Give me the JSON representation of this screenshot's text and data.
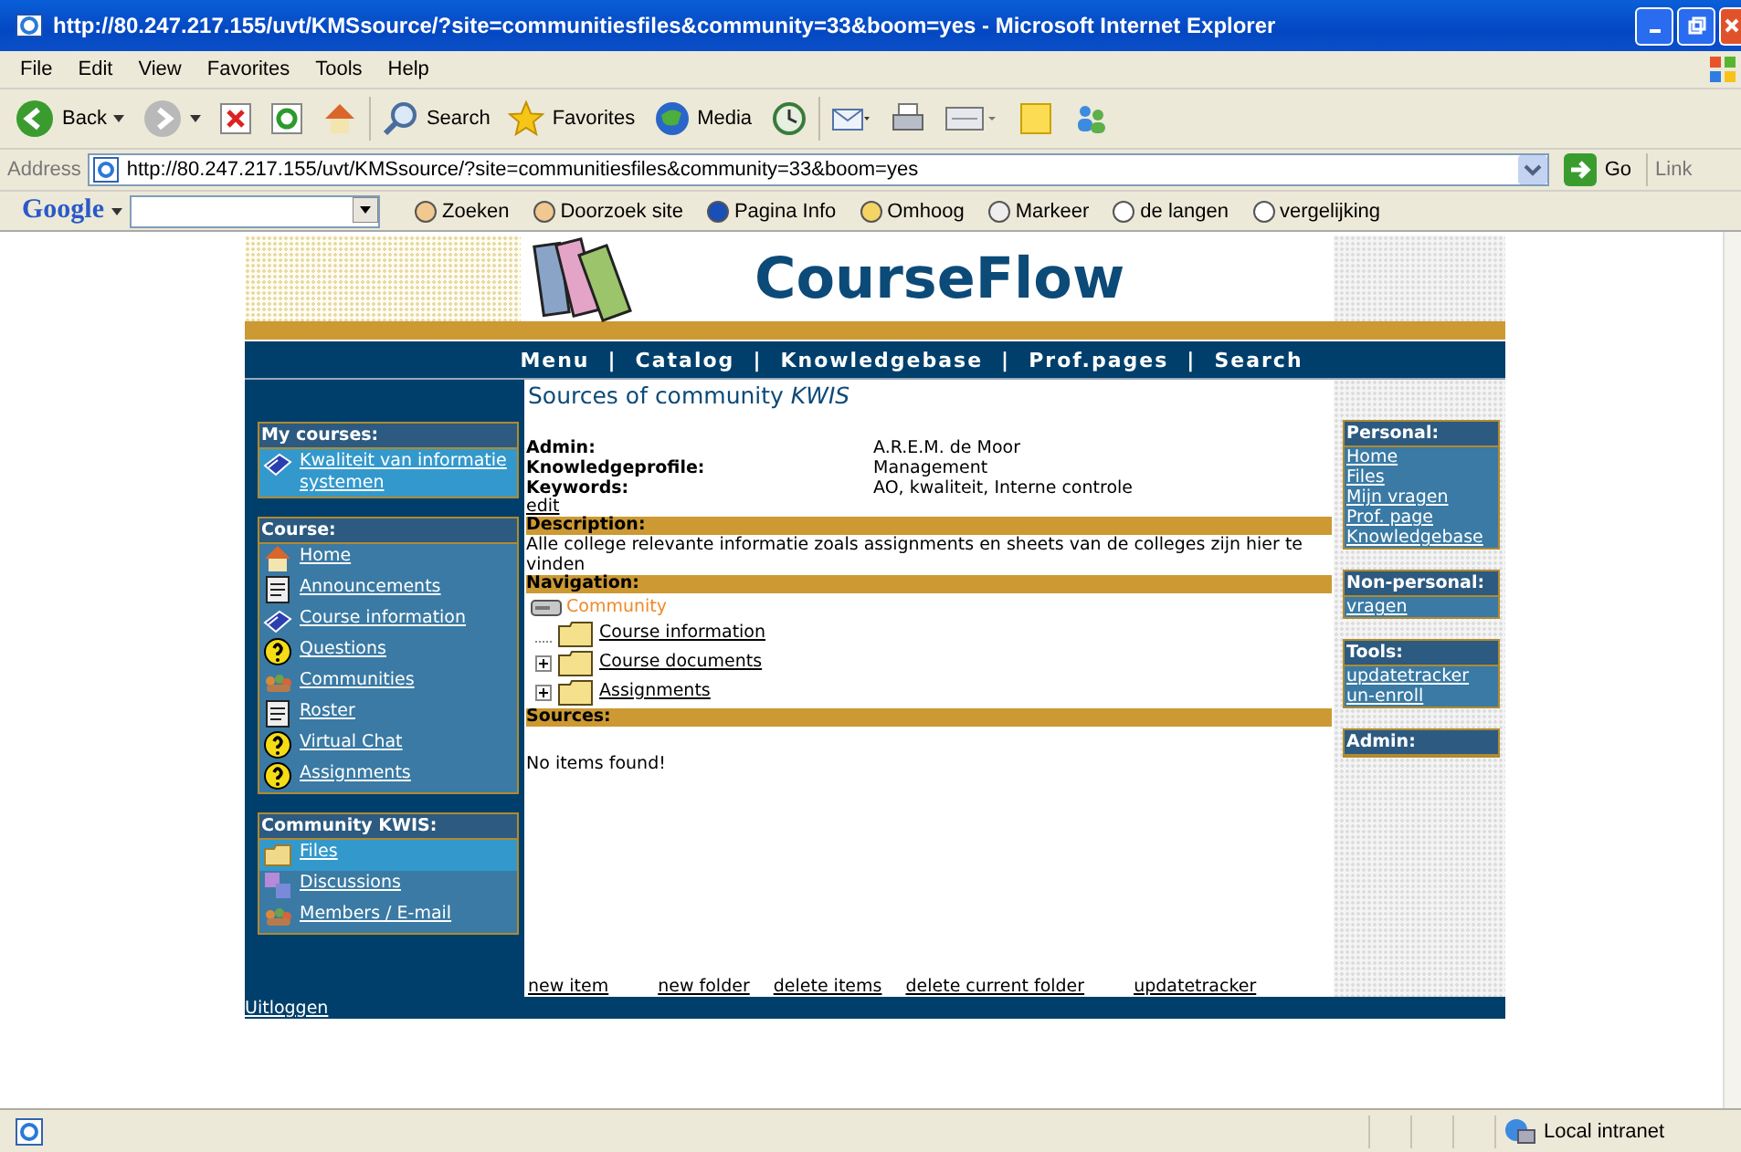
{
  "window": {
    "title": "http://80.247.217.155/uvt/KMSsource/?site=communitiesfiles&community=33&boom=yes - Microsoft Internet Explorer"
  },
  "menu_bar": [
    "File",
    "Edit",
    "View",
    "Favorites",
    "Tools",
    "Help"
  ],
  "toolbar": [
    {
      "kind": "back",
      "label": "Back"
    },
    {
      "kind": "forward"
    },
    {
      "kind": "stop"
    },
    {
      "kind": "refresh"
    },
    {
      "kind": "home"
    },
    {
      "kind": "search",
      "label": "Search"
    },
    {
      "kind": "favorites",
      "label": "Favorites"
    },
    {
      "kind": "media",
      "label": "Media"
    },
    {
      "kind": "history"
    },
    {
      "kind": "mail"
    },
    {
      "kind": "print"
    },
    {
      "kind": "edit"
    },
    {
      "kind": "note"
    },
    {
      "kind": "messenger"
    }
  ],
  "address": {
    "label": "Address",
    "value": "http://80.247.217.155/uvt/KMSsource/?site=communitiesfiles&community=33&boom=yes",
    "go": "Go",
    "links": "Link"
  },
  "google_bar": {
    "logo": "Google",
    "items": [
      "Zoeken",
      "Doorzoek site",
      "Pagina Info",
      "Omhoog",
      "Markeer",
      "de langen",
      "vergelijking"
    ]
  },
  "page": {
    "logo": "CourseFlow",
    "nav": [
      "Menu",
      "Catalog",
      "Knowledgebase",
      "Prof.pages",
      "Search"
    ],
    "nav_separator": "|",
    "left_panels": [
      {
        "title": "My courses:",
        "items": [
          {
            "kind": "book",
            "label": "Kwaliteit van informatie systemen",
            "selected": true
          }
        ]
      },
      {
        "title": "Course:",
        "items": [
          {
            "kind": "home",
            "label": "Home",
            "selected": false
          },
          {
            "kind": "doc",
            "label": "Announcements",
            "selected": false
          },
          {
            "kind": "book",
            "label": "Course information",
            "selected": false
          },
          {
            "kind": "question",
            "label": "Questions",
            "selected": false
          },
          {
            "kind": "people",
            "label": "Communities",
            "selected": false
          },
          {
            "kind": "doc",
            "label": "Roster",
            "selected": false
          },
          {
            "kind": "question",
            "label": "Virtual Chat",
            "selected": false
          },
          {
            "kind": "question",
            "label": "Assignments",
            "selected": false
          }
        ]
      },
      {
        "title": "Community KWIS:",
        "items": [
          {
            "kind": "folder",
            "label": "Files",
            "selected": true
          },
          {
            "kind": "chat",
            "label": "Discussions",
            "selected": false
          },
          {
            "kind": "people",
            "label": "Members / E-mail",
            "selected": false
          }
        ]
      }
    ],
    "heading": "Sources of community *KWIS*",
    "info": [
      {
        "label": "Admin:",
        "value": "A.R.E.M. de Moor"
      },
      {
        "label": "Knowledgeprofile:",
        "value": "Management"
      },
      {
        "label": "Keywords:",
        "value": "AO, kwaliteit, Interne controle"
      }
    ],
    "edit_link": "edit",
    "description_title": "Description:",
    "description": "Alle college relevante informatie zoals assignments en sheets van de colleges zijn hier te vinden",
    "navigation_title": "Navigation:",
    "tree": {
      "label": "Community",
      "children": [
        {
          "label": "Course information",
          "expandable": false
        },
        {
          "label": "Course documents",
          "expandable": true
        },
        {
          "label": "Assignments",
          "expandable": true
        }
      ]
    },
    "sources_title": "Sources:",
    "empty_message": "No items found!",
    "actions": [
      "new item",
      "new folder",
      "delete items",
      "delete current folder",
      "updatetracker"
    ],
    "right_panels": [
      {
        "title": "Personal:",
        "items": [
          "Home",
          "Files",
          "Mijn vragen",
          "Prof. page",
          "Knowledgebase"
        ]
      },
      {
        "title": "Non-personal:",
        "items": [
          "vragen"
        ]
      },
      {
        "title": "Tools:",
        "items": [
          "updatetracker",
          "un-enroll"
        ]
      },
      {
        "title": "Admin:"
      }
    ],
    "footer_link": "Uitloggen"
  },
  "status_bar": {
    "zone": "Local intranet"
  }
}
